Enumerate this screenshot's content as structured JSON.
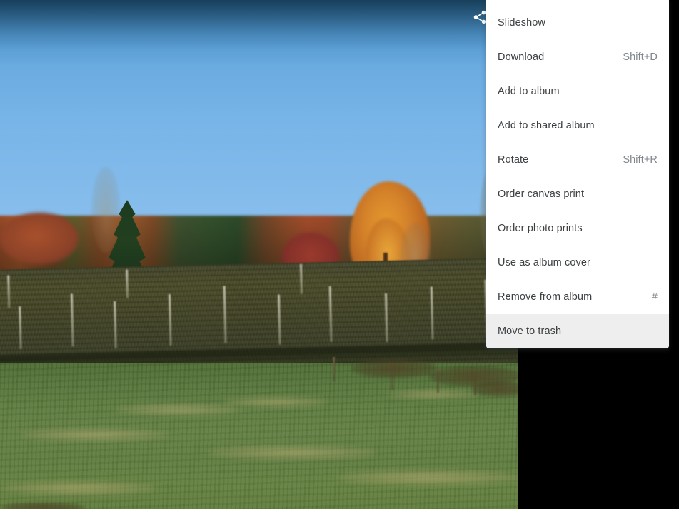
{
  "app": {
    "name": "photo-viewer",
    "background_color": "#000000"
  },
  "toolbar": {
    "share_icon": "share-icon",
    "share_label": "Share"
  },
  "photo": {
    "alt": "Autumn vineyard landscape with orange and red tree line under blue sky",
    "sky_color_top": "#2a6d9e",
    "sky_color_bottom": "#93c4ef",
    "grass_color": "#5c7b3f",
    "vineyard_color": "#3c3e1e",
    "maple_color": "#d5822a"
  },
  "menu": {
    "name": "photo-options-menu",
    "background": "#ffffff",
    "text_color": "#3c4043",
    "shortcut_color": "#80868b",
    "hover_background": "#eeeeee",
    "items": [
      {
        "label": "Slideshow",
        "shortcut": "",
        "hover": false
      },
      {
        "label": "Download",
        "shortcut": "Shift+D",
        "hover": false
      },
      {
        "label": "Add to album",
        "shortcut": "",
        "hover": false
      },
      {
        "label": "Add to shared album",
        "shortcut": "",
        "hover": false
      },
      {
        "label": "Rotate",
        "shortcut": "Shift+R",
        "hover": false
      },
      {
        "label": "Order canvas print",
        "shortcut": "",
        "hover": false
      },
      {
        "label": "Order photo prints",
        "shortcut": "",
        "hover": false
      },
      {
        "label": "Use as album cover",
        "shortcut": "",
        "hover": false
      },
      {
        "label": "Remove from album",
        "shortcut": "#",
        "hover": false
      },
      {
        "label": "Move to trash",
        "shortcut": "",
        "hover": true
      }
    ]
  }
}
